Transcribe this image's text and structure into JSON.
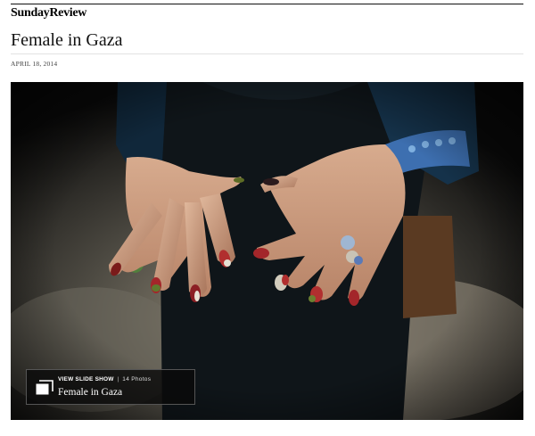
{
  "section": {
    "label": "SundayReview"
  },
  "article": {
    "title": "Female in Gaza",
    "date": "APRIL 18, 2014"
  },
  "photo": {
    "subject": "hands-with-painted-nails"
  },
  "slideshow": {
    "cta_label": "VIEW SLIDE SHOW",
    "separator": "|",
    "count": "14 Photos",
    "title": "Female in Gaza",
    "icon": "slideshow-icon"
  }
}
